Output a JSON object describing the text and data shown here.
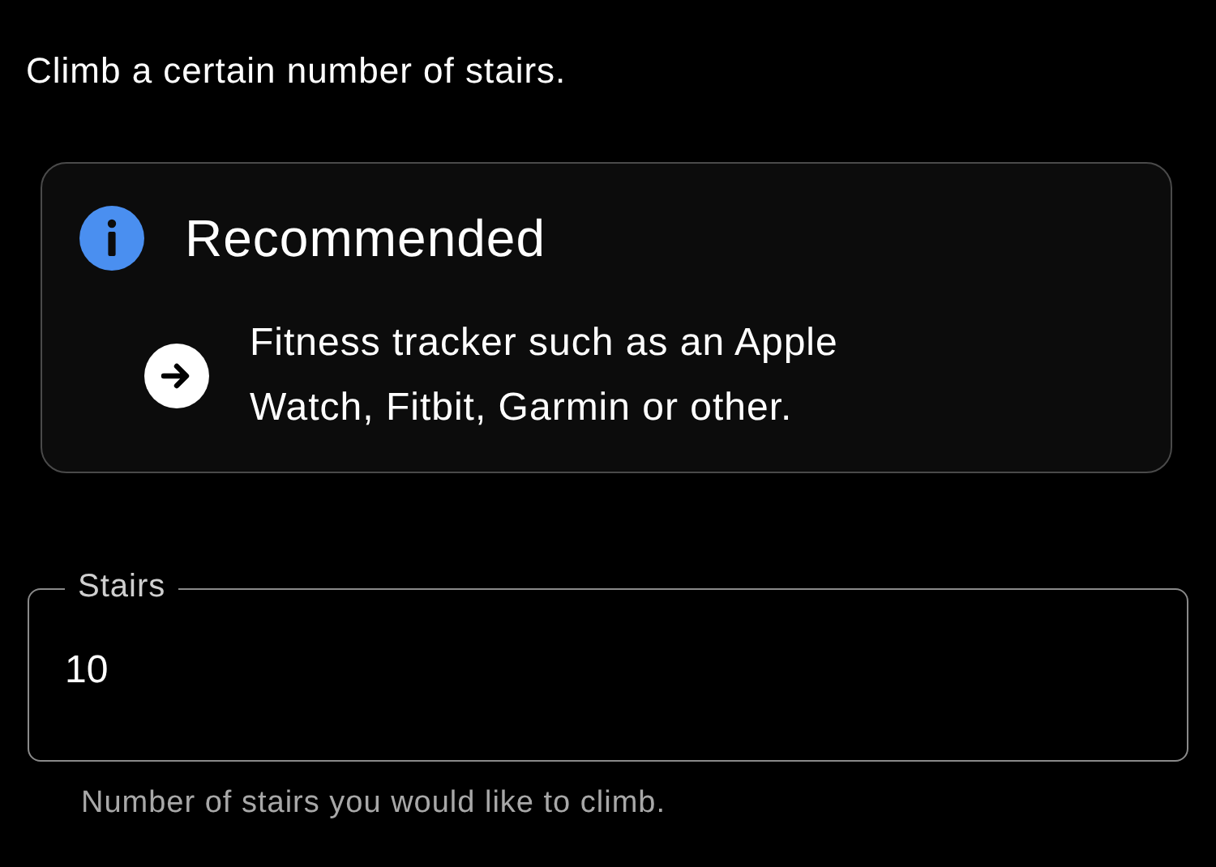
{
  "description": "Climb a certain number of stairs.",
  "recommended": {
    "title": "Recommended",
    "items": [
      "Fitness tracker such as an Apple Watch, Fitbit, Garmin or other."
    ]
  },
  "field": {
    "label": "Stairs",
    "value": "10",
    "helper": "Number of stairs you would like to climb."
  }
}
